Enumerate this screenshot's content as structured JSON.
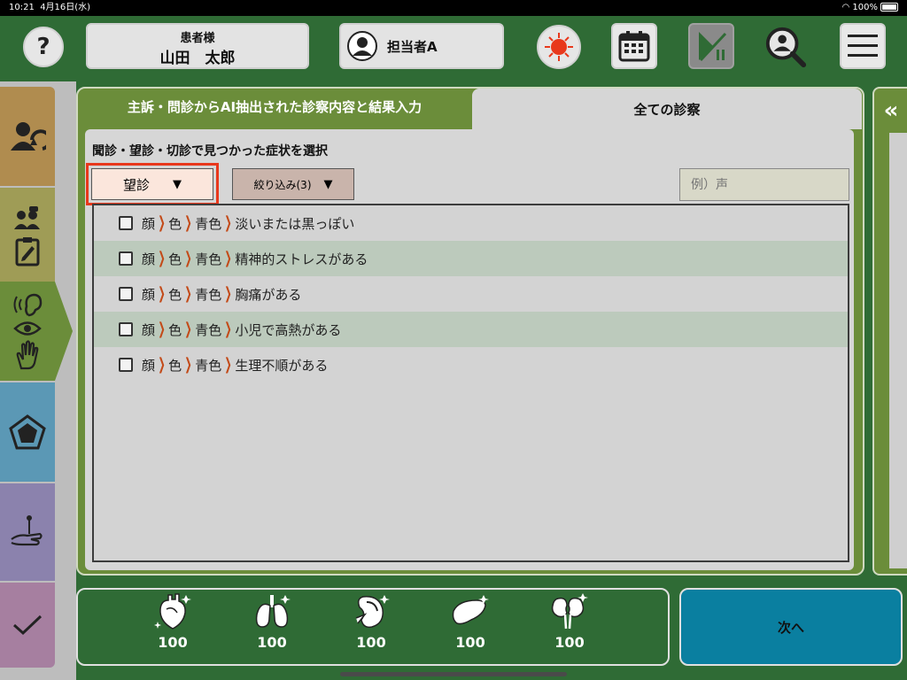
{
  "status": {
    "time": "10:21",
    "date": "4月16日(水)",
    "battery": "100%"
  },
  "header": {
    "help_label": "?",
    "patient_label": "患者様",
    "patient_name": "山田　太郎",
    "staff_name": "担当者A"
  },
  "tabs": {
    "extracted": "主訴・問診からAI抽出された診察内容と結果入力",
    "all": "全ての診察"
  },
  "section_title": "聞診・望診・切診で見つかった症状を選択",
  "filters": {
    "category": "望診",
    "category_arrow": "▼",
    "narrow": "絞り込み(3)",
    "narrow_arrow": "▼",
    "search_placeholder": "例）声"
  },
  "symptoms": [
    {
      "path": [
        "顔",
        "色",
        "青色"
      ],
      "text": "淡いまたは黒っぽい"
    },
    {
      "path": [
        "顔",
        "色",
        "青色"
      ],
      "text": "精神的ストレスがある"
    },
    {
      "path": [
        "顔",
        "色",
        "青色"
      ],
      "text": "胸痛がある"
    },
    {
      "path": [
        "顔",
        "色",
        "青色"
      ],
      "text": "小児で高熱がある"
    },
    {
      "path": [
        "顔",
        "色",
        "青色"
      ],
      "text": "生理不順がある"
    }
  ],
  "organs": [
    {
      "icon": "heart-icon",
      "value": "100"
    },
    {
      "icon": "lungs-icon",
      "value": "100"
    },
    {
      "icon": "kidney-section-icon",
      "value": "100"
    },
    {
      "icon": "liver-icon",
      "value": "100"
    },
    {
      "icon": "kidneys-icon",
      "value": "100"
    }
  ],
  "next_label": "次へ",
  "collapse_label": "«",
  "colors": {
    "header_green": "#2f6b35",
    "panel_olive": "#6b8d3a",
    "accent_red": "#e8381c",
    "next_blue": "#0a7fa0"
  }
}
